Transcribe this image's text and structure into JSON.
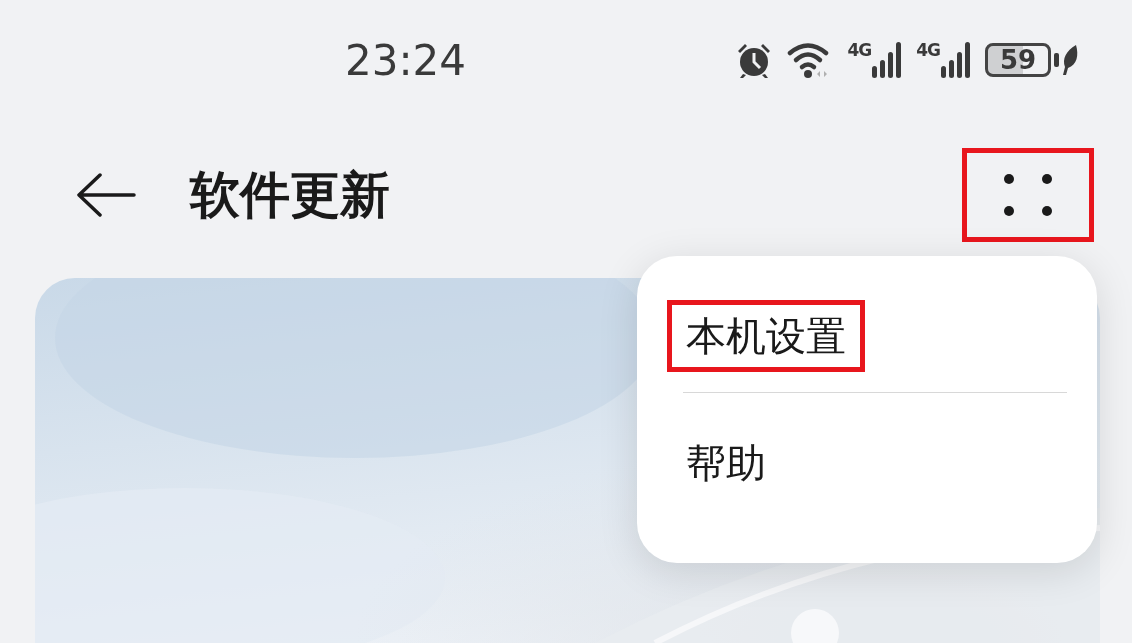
{
  "status_bar": {
    "time": "23:24",
    "networks": [
      "4G",
      "4G"
    ],
    "battery": "59"
  },
  "header": {
    "title": "软件更新",
    "more_button": {
      "highlighted": true
    }
  },
  "menu": {
    "items": [
      {
        "label": "本机设置",
        "highlighted": true
      },
      {
        "label": "帮助",
        "highlighted": false
      }
    ]
  }
}
